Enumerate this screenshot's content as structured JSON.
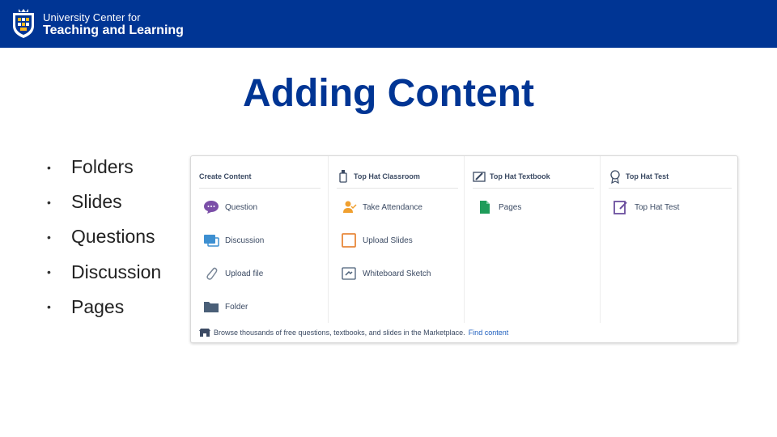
{
  "header": {
    "logo_line1": "University Center for",
    "logo_line2": "Teaching and Learning",
    "color": "#003594"
  },
  "slide": {
    "title": "Adding Content",
    "bullets": [
      "Folders",
      "Slides",
      "Questions",
      "Discussion",
      "Pages"
    ]
  },
  "tophat_menu": {
    "columns": [
      {
        "heading": "Create Content",
        "items": [
          {
            "label": "Question",
            "icon": "question-bubble-icon"
          },
          {
            "label": "Discussion",
            "icon": "discussion-icon"
          },
          {
            "label": "Upload file",
            "icon": "paperclip-icon"
          },
          {
            "label": "Folder",
            "icon": "folder-icon"
          }
        ]
      },
      {
        "heading": "Top Hat Classroom",
        "heading_icon": "classroom-icon",
        "items": [
          {
            "label": "Take Attendance",
            "icon": "attendance-icon"
          },
          {
            "label": "Upload Slides",
            "icon": "slides-icon"
          },
          {
            "label": "Whiteboard Sketch",
            "icon": "whiteboard-icon"
          }
        ]
      },
      {
        "heading": "Top Hat Textbook",
        "heading_icon": "textbook-icon",
        "items": [
          {
            "label": "Pages",
            "icon": "pages-icon"
          }
        ]
      },
      {
        "heading": "Top Hat Test",
        "heading_icon": "test-badge-icon",
        "items": [
          {
            "label": "Top Hat Test",
            "icon": "test-icon"
          }
        ]
      }
    ],
    "footer_text": "Browse thousands of free questions, textbooks, and slides in the Marketplace.",
    "footer_link": "Find content",
    "footer_icon": "marketplace-icon",
    "colors": {
      "question": "#7b4fa8",
      "discussion": "#3d8fd1",
      "attendance": "#f0a030",
      "slides": "#e8883a",
      "pages": "#1e9c5a",
      "test": "#6c4f9e",
      "folder": "#4a5f78"
    }
  }
}
